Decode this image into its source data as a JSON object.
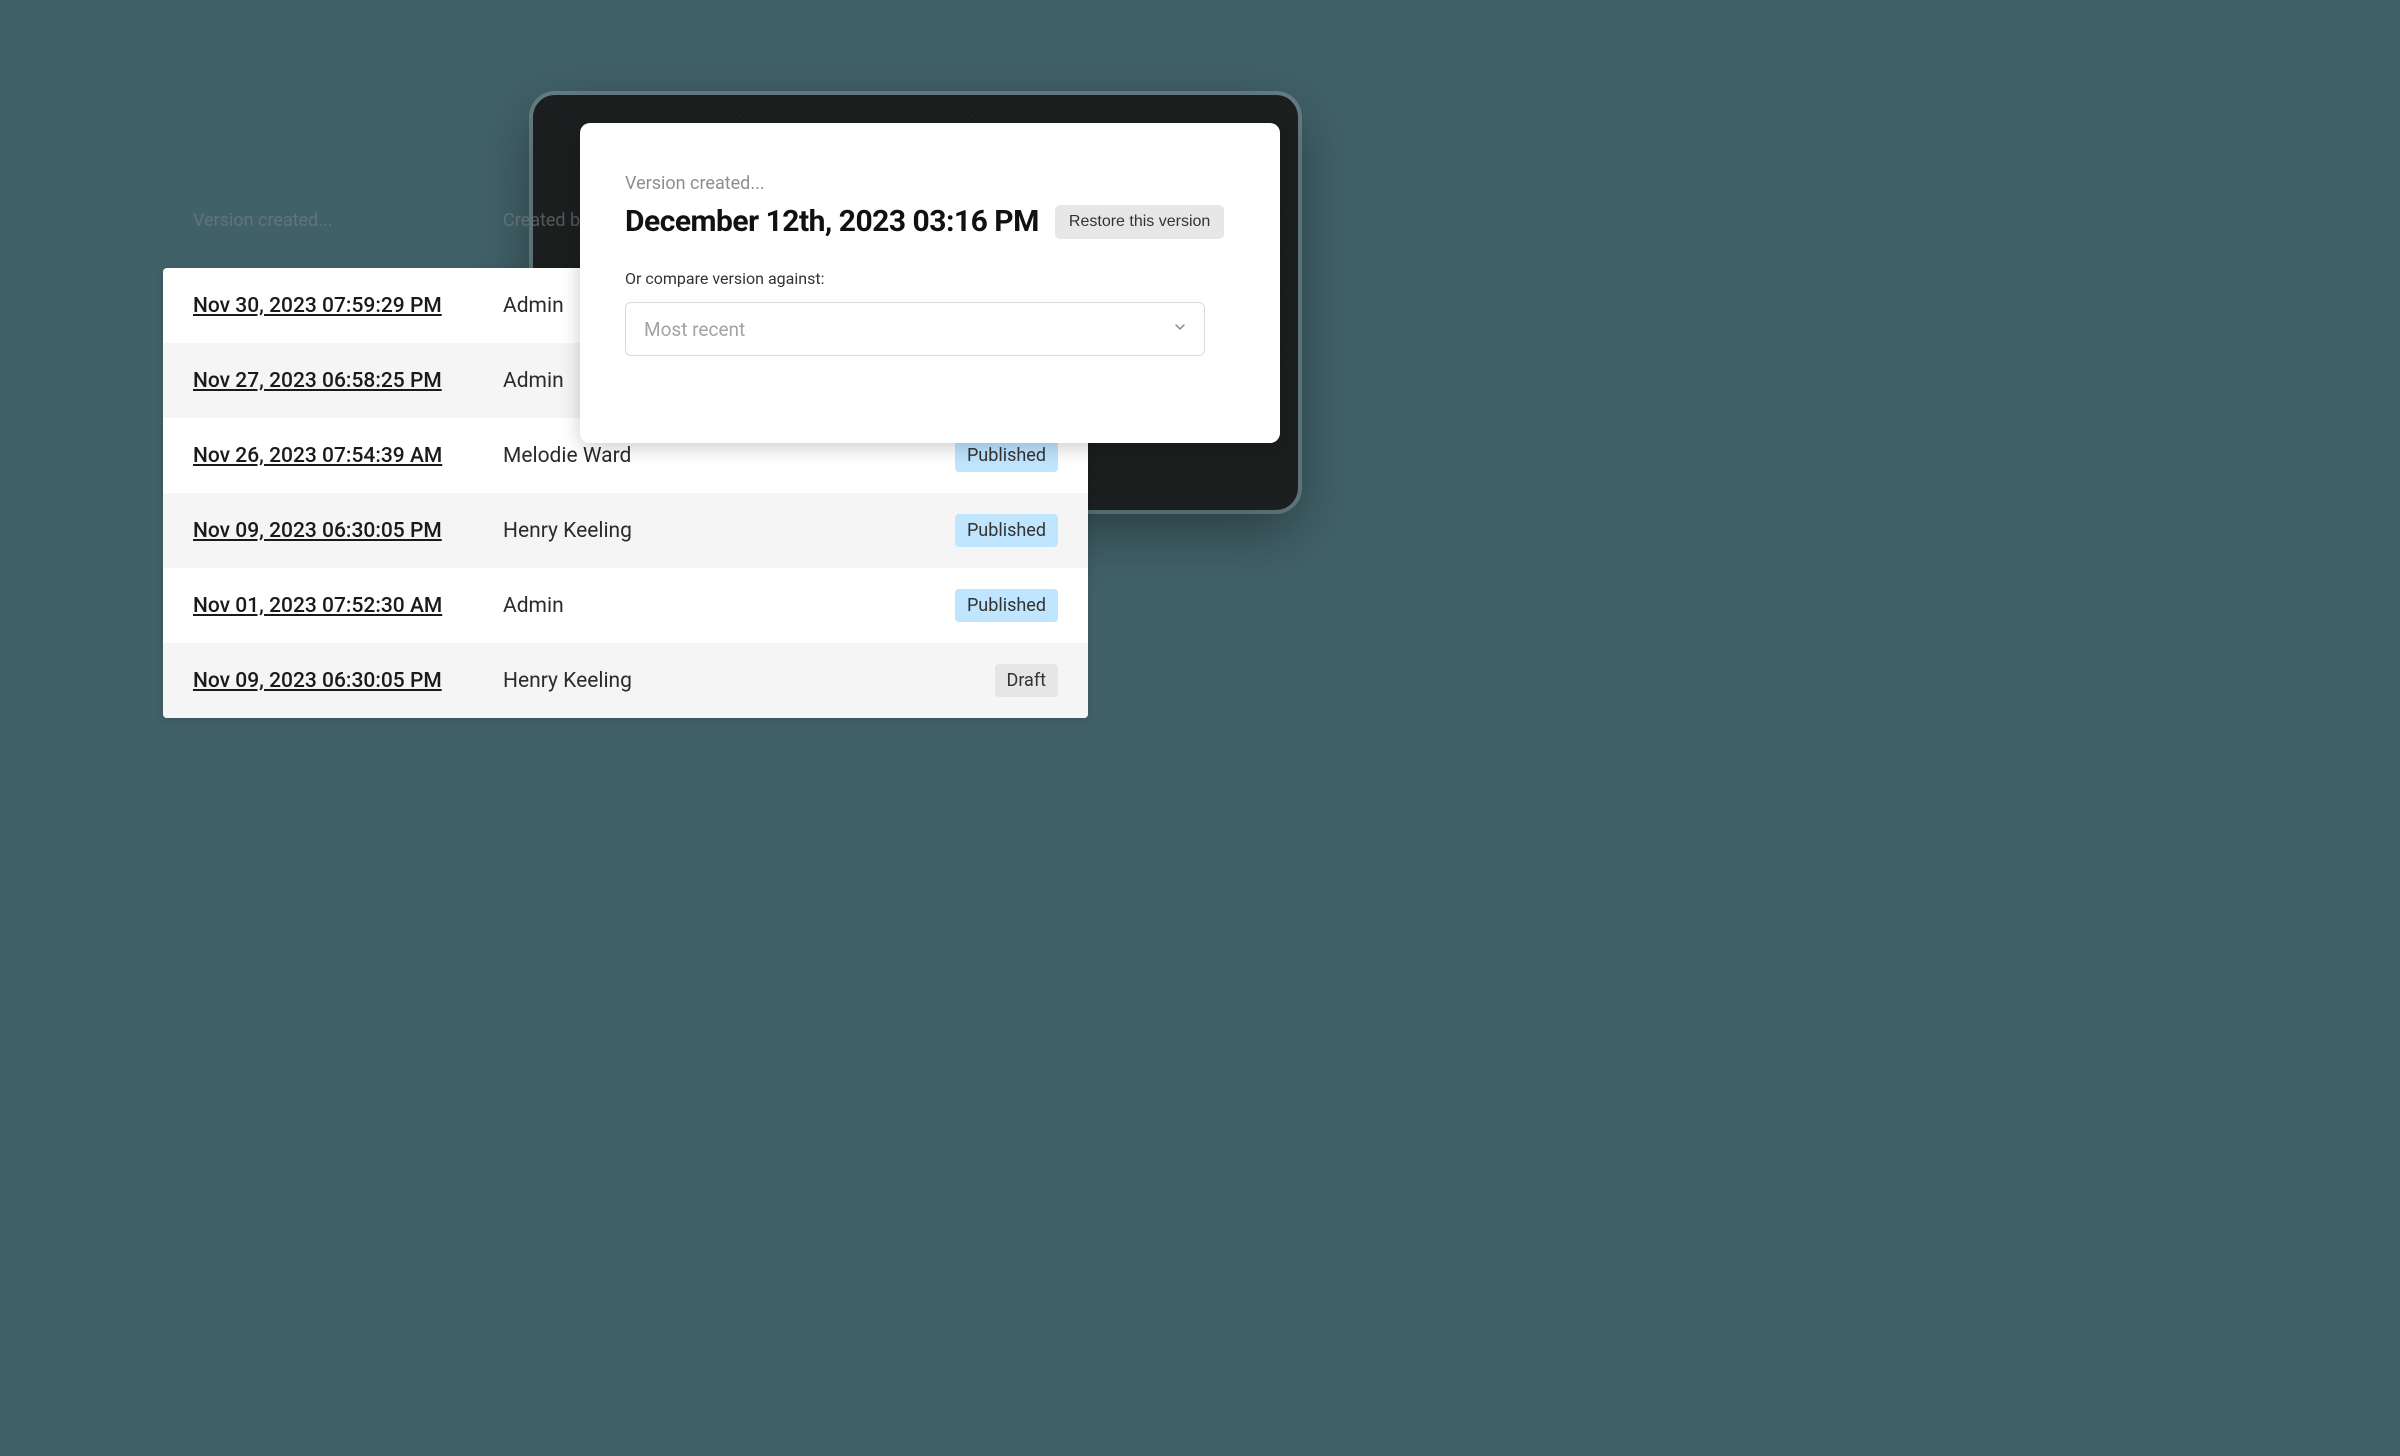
{
  "table": {
    "columns": {
      "date": "Version created...",
      "by": "Created by"
    },
    "rows": [
      {
        "date": "Nov 30, 2023 07:59:29 PM",
        "by": "Admin",
        "status": ""
      },
      {
        "date": "Nov 27, 2023 06:58:25 PM",
        "by": "Admin",
        "status": ""
      },
      {
        "date": "Nov 26, 2023 07:54:39 AM",
        "by": "Melodie Ward",
        "status": "Published"
      },
      {
        "date": "Nov 09, 2023 06:30:05 PM",
        "by": "Henry Keeling",
        "status": "Published"
      },
      {
        "date": "Nov 01, 2023 07:52:30 AM",
        "by": "Admin",
        "status": "Published"
      },
      {
        "date": "Nov 09, 2023 06:30:05 PM",
        "by": "Henry Keeling",
        "status": "Draft"
      }
    ]
  },
  "detail": {
    "sub": "Version created...",
    "title": "December 12th, 2023 03:16 PM",
    "restore_label": "Restore this version",
    "compare_label": "Or compare version against:",
    "compare_value": "Most recent"
  },
  "status_styles": {
    "Published": "badge-published",
    "Draft": "badge-draft"
  }
}
